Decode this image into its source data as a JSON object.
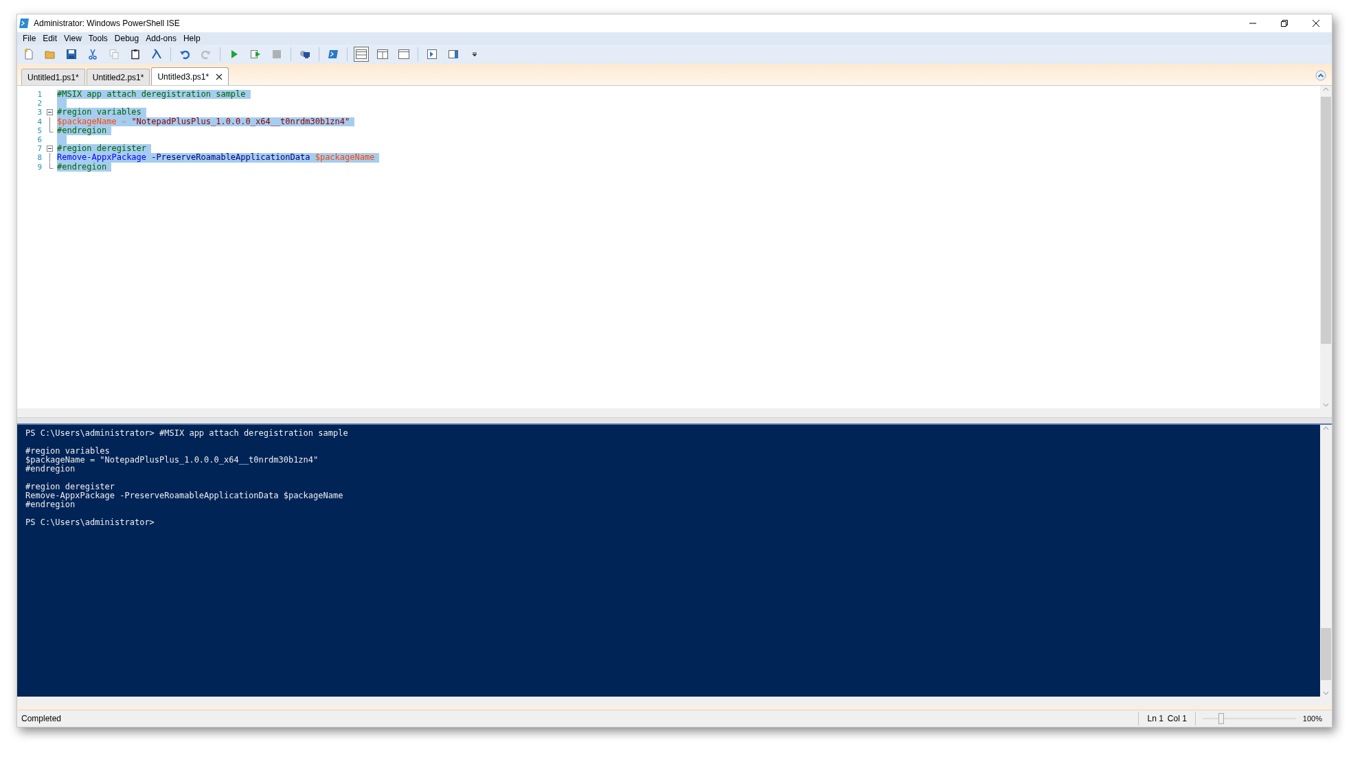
{
  "window": {
    "title": "Administrator: Windows PowerShell ISE"
  },
  "menu": [
    {
      "label": "File"
    },
    {
      "label": "Edit"
    },
    {
      "label": "View"
    },
    {
      "label": "Tools"
    },
    {
      "label": "Debug"
    },
    {
      "label": "Add-ons"
    },
    {
      "label": "Help"
    }
  ],
  "toolbar": [
    {
      "kind": "new",
      "disabled": false
    },
    {
      "kind": "open",
      "disabled": false
    },
    {
      "kind": "save",
      "disabled": false
    },
    {
      "kind": "cut",
      "disabled": false
    },
    {
      "kind": "copy",
      "disabled": true
    },
    {
      "kind": "paste",
      "disabled": false
    },
    {
      "kind": "clear",
      "disabled": false
    },
    {
      "kind": "separator"
    },
    {
      "kind": "undo",
      "disabled": false
    },
    {
      "kind": "redo",
      "disabled": true
    },
    {
      "kind": "separator"
    },
    {
      "kind": "run",
      "disabled": false
    },
    {
      "kind": "run-selection",
      "disabled": false
    },
    {
      "kind": "stop",
      "disabled": true
    },
    {
      "kind": "separator"
    },
    {
      "kind": "remote",
      "disabled": false
    },
    {
      "kind": "separator"
    },
    {
      "kind": "console",
      "disabled": false
    },
    {
      "kind": "separator"
    },
    {
      "kind": "layout-top",
      "selected": true
    },
    {
      "kind": "layout-right",
      "selected": false
    },
    {
      "kind": "layout-max",
      "selected": false
    },
    {
      "kind": "separator"
    },
    {
      "kind": "show-script",
      "disabled": false
    },
    {
      "kind": "show-addon",
      "disabled": false
    },
    {
      "kind": "overflow",
      "disabled": false
    }
  ],
  "tabs": [
    {
      "label": "Untitled1.ps1*",
      "selected": false
    },
    {
      "label": "Untitled2.ps1*",
      "selected": false
    },
    {
      "label": "Untitled3.ps1*",
      "selected": true
    }
  ],
  "editor": {
    "lines": [
      {
        "number": "1",
        "selected": true,
        "kind": "plain",
        "tokens": [
          {
            "kind": "comment",
            "text": "#MSIX app attach deregistration sample"
          }
        ]
      },
      {
        "number": "2",
        "selected": true,
        "kind": "plain"
      },
      {
        "number": "3",
        "selected": true,
        "kind": "foldstart",
        "tokens": [
          {
            "kind": "comment",
            "text": "#region variables"
          }
        ]
      },
      {
        "number": "4",
        "selected": true,
        "kind": "foldinner",
        "tokens": [
          {
            "kind": "variable",
            "text": "$packageName"
          },
          {
            "kind": "operator",
            "text": "="
          },
          {
            "kind": "string",
            "text": "\"NotepadPlusPlus_1.0.0.0_x64__t0nrdm30b1zn4\""
          }
        ]
      },
      {
        "number": "5",
        "selected": true,
        "kind": "foldend",
        "tokens": [
          {
            "kind": "comment",
            "text": "#endregion"
          }
        ]
      },
      {
        "number": "6",
        "selected": true,
        "kind": "plain"
      },
      {
        "number": "7",
        "selected": true,
        "kind": "foldstart",
        "tokens": [
          {
            "kind": "comment",
            "text": "#region deregister"
          }
        ]
      },
      {
        "number": "8",
        "selected": true,
        "kind": "foldinner",
        "tokens": [
          {
            "kind": "command",
            "text": "Remove-AppxPackage"
          },
          {
            "kind": "parameter",
            "text": "-PreserveRoamableApplicationData"
          },
          {
            "kind": "variable",
            "text": "$packageName"
          }
        ]
      },
      {
        "number": "9",
        "selected": true,
        "kind": "foldend",
        "tokens": [
          {
            "kind": "comment",
            "text": "#endregion"
          }
        ]
      }
    ]
  },
  "console": {
    "blocks": [
      [
        "PS C:\\Users\\administrator> #MSIX app attach deregistration sample"
      ],
      [
        "#region variables",
        "$packageName = \"NotepadPlusPlus_1.0.0.0_x64__t0nrdm30b1zn4\"",
        "#endregion"
      ],
      [
        "#region deregister",
        "Remove-AppxPackage -PreserveRoamableApplicationData $packageName",
        "#endregion"
      ],
      [
        "PS C:\\Users\\administrator>"
      ]
    ]
  },
  "status_bar": {
    "text": "Completed",
    "line": "Ln 1",
    "column": "Col 1",
    "zoom": {
      "level": 0.2
    },
    "zoom_reading": "100%"
  }
}
